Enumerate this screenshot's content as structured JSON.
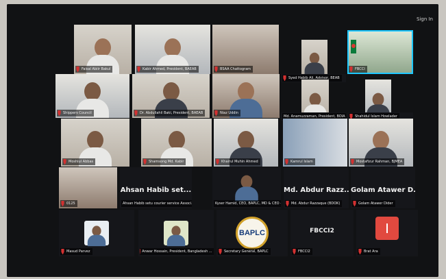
{
  "screen": {
    "sign_in": "Sign In"
  },
  "tiles": [
    {
      "id": "t1",
      "label": "Faisal Abiir Bakul"
    },
    {
      "id": "t2",
      "label": "Kabir Ahmed, President, BAEAB"
    },
    {
      "id": "t3",
      "label": "BSAA Chattogram"
    },
    {
      "id": "t4",
      "label": "Syed Habib Ali, Advisor, BEAB"
    },
    {
      "id": "t5",
      "label": "FBCCI"
    },
    {
      "id": "t6",
      "label": "Shippers Council"
    },
    {
      "id": "t7",
      "label": "Dr. Abdullahil Baki, President, BAEAB"
    },
    {
      "id": "t8",
      "label": "Niaz Uddin"
    },
    {
      "id": "t9",
      "label": "Md. Anamuzzaman, President, BOIA"
    },
    {
      "id": "t10",
      "label": "Shahidul Islam Howlader"
    },
    {
      "id": "t11",
      "label": "Moshiul Abbas"
    },
    {
      "id": "t12",
      "label": "Shamsong Md. Kabir"
    },
    {
      "id": "t13",
      "label": "Khairul Muhin Ahmed"
    },
    {
      "id": "t14",
      "label": "Kamrul Islam"
    },
    {
      "id": "t15",
      "label": "Mostafizur Rahman, BJMEA"
    },
    {
      "id": "t16",
      "label": "0125"
    },
    {
      "id": "t17",
      "name": "Ahsan Habib set...",
      "label": "Ahsan Habib setu courier service Associ..."
    },
    {
      "id": "t18",
      "label": "Kyser Hamid, CEO, BAPLC, MD & CEO - Be..."
    },
    {
      "id": "t19",
      "name": "Md. Abdur Razz...",
      "label": "Md. Abdur Razzaque (BDOK)"
    },
    {
      "id": "t20",
      "name": "Golam Atawer D...",
      "label": "Golam Atawer Dider"
    },
    {
      "id": "t21",
      "label": "Masud Parvez"
    },
    {
      "id": "t22",
      "label": "Anwar Hossain, President, Bangladesh ..."
    },
    {
      "id": "t23",
      "logo": "BAPLC",
      "label": "Secretary General, BAPLC"
    },
    {
      "id": "t24",
      "name": "FBCCI2",
      "label": "FBCCI2"
    },
    {
      "id": "t25",
      "label": "Brat Ara"
    }
  ]
}
